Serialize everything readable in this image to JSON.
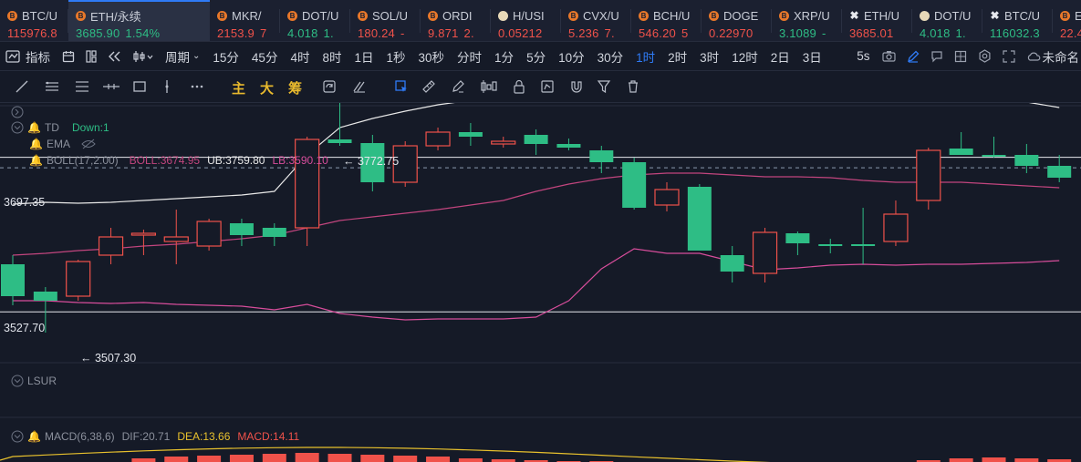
{
  "ticker": [
    {
      "symbol": "BTC/U",
      "price": "115976.8",
      "change": "",
      "dir": "dn",
      "icon": "coin-dot-icon"
    },
    {
      "symbol": "ETH/永续",
      "price": "3685.90",
      "change": "1.54%",
      "dir": "up",
      "icon": "coin-dot-icon",
      "active": true
    },
    {
      "symbol": "MKR/",
      "price": "2153.9",
      "change": "7",
      "dir": "dn",
      "icon": "coin-dot-icon"
    },
    {
      "symbol": "DOT/U",
      "price": "4.018",
      "change": "1.",
      "dir": "up",
      "icon": "coin-dot-icon"
    },
    {
      "symbol": "SOL/U",
      "price": "180.24",
      "change": "-",
      "dir": "dn",
      "icon": "coin-dot-icon"
    },
    {
      "symbol": "ORDI",
      "price": "9.871",
      "change": "2.",
      "dir": "dn",
      "icon": "coin-dot-icon"
    },
    {
      "symbol": "H/USI",
      "price": "0.05212",
      "change": "",
      "dir": "dn",
      "icon": "coin-light-icon"
    },
    {
      "symbol": "CVX/U",
      "price": "5.236",
      "change": "7.",
      "dir": "dn",
      "icon": "coin-dot-icon"
    },
    {
      "symbol": "BCH/U",
      "price": "546.20",
      "change": "5",
      "dir": "dn",
      "icon": "coin-dot-icon"
    },
    {
      "symbol": "DOGE",
      "price": "0.22970",
      "change": "",
      "dir": "dn",
      "icon": "coin-dot-icon"
    },
    {
      "symbol": "XRP/U",
      "price": "3.1089",
      "change": "-",
      "dir": "up",
      "icon": "coin-dot-icon"
    },
    {
      "symbol": "ETH/U",
      "price": "3685.01",
      "change": "",
      "dir": "dn",
      "icon": "exchange-x-icon"
    },
    {
      "symbol": "DOT/U",
      "price": "4.018",
      "change": "1.",
      "dir": "up",
      "icon": "coin-light-icon"
    },
    {
      "symbol": "BTC/U",
      "price": "116032.3",
      "change": "",
      "dir": "up",
      "icon": "exchange-x-icon"
    },
    {
      "symbol": "ETC/L",
      "price": "22.468",
      "change": "0",
      "dir": "dn",
      "icon": "coin-dot-icon"
    }
  ],
  "toolbar": {
    "indicators_label": "指标",
    "period_label": "周期",
    "periods": [
      "15分",
      "45分",
      "4时",
      "8时",
      "1日",
      "1秒",
      "30秒",
      "分时",
      "1分",
      "5分",
      "10分",
      "30分",
      "1时",
      "2时",
      "3时",
      "12时",
      "2日",
      "3日"
    ],
    "selected_period": "1时",
    "right_interval": "5s",
    "layout_name": "未命名"
  },
  "drawbar": {
    "main_label": "主",
    "big_label": "大",
    "chip_label": "筹"
  },
  "chart_data": [
    {
      "type": "candlestick",
      "title": "ETH/永续 1时",
      "ylim": [
        3490,
        3790
      ],
      "price_labels": {
        "upper": "3697.35",
        "lower": "3527.70"
      },
      "annotations": {
        "high": "3772.75",
        "low": "3507.30"
      },
      "x": [
        1,
        2,
        3,
        4,
        5,
        6,
        7,
        8,
        9,
        10,
        11,
        12,
        13,
        14,
        15,
        16,
        17,
        18,
        19,
        20,
        21,
        22,
        23,
        24,
        25,
        26,
        27,
        28,
        29,
        30,
        31,
        32,
        33
      ],
      "ohlc": [
        [
          3580,
          3590,
          3535,
          3545
        ],
        [
          3550,
          3555,
          3505,
          3540
        ],
        [
          3545,
          3585,
          3540,
          3583
        ],
        [
          3590,
          3620,
          3580,
          3610
        ],
        [
          3612,
          3618,
          3590,
          3614
        ],
        [
          3605,
          3640,
          3580,
          3610
        ],
        [
          3600,
          3630,
          3595,
          3627
        ],
        [
          3625,
          3630,
          3600,
          3612
        ],
        [
          3620,
          3625,
          3600,
          3610
        ],
        [
          3620,
          3720,
          3600,
          3717
        ],
        [
          3717,
          3773,
          3710,
          3713
        ],
        [
          3713,
          3722,
          3660,
          3670
        ],
        [
          3670,
          3715,
          3665,
          3710
        ],
        [
          3710,
          3730,
          3705,
          3725
        ],
        [
          3725,
          3735,
          3710,
          3720
        ],
        [
          3712,
          3720,
          3708,
          3715
        ],
        [
          3722,
          3728,
          3700,
          3712
        ],
        [
          3712,
          3718,
          3705,
          3708
        ],
        [
          3705,
          3710,
          3680,
          3692
        ],
        [
          3692,
          3697,
          3640,
          3642
        ],
        [
          3645,
          3670,
          3638,
          3662
        ],
        [
          3665,
          3668,
          3595,
          3595
        ],
        [
          3590,
          3600,
          3560,
          3572
        ],
        [
          3570,
          3620,
          3560,
          3615
        ],
        [
          3614,
          3616,
          3590,
          3603
        ],
        [
          3602,
          3608,
          3592,
          3600
        ],
        [
          3602,
          3642,
          3580,
          3600
        ],
        [
          3605,
          3650,
          3600,
          3635
        ],
        [
          3650,
          3708,
          3640,
          3705
        ],
        [
          3707,
          3725,
          3700,
          3700
        ],
        [
          3700,
          3720,
          3697,
          3698
        ],
        [
          3700,
          3712,
          3680,
          3688
        ],
        [
          3688,
          3700,
          3670,
          3675
        ]
      ],
      "indicators": {
        "td": {
          "label": "TD",
          "value_label": "Down:1"
        },
        "ema": {
          "label": "EMA"
        },
        "boll": {
          "label": "BOLL(17,2.00)",
          "boll_label": "BOLL:3674.95",
          "ub_label": "UB:3759.80",
          "lb_label": "LB:3590.10",
          "ub": [
            3646,
            3648,
            3647,
            3648,
            3650,
            3652,
            3654,
            3656,
            3660,
            3700,
            3730,
            3740,
            3748,
            3755,
            3760,
            3768,
            3775,
            3778,
            3778,
            3775,
            3770,
            3768,
            3765,
            3762,
            3760,
            3760,
            3760,
            3760,
            3758,
            3762,
            3762,
            3758,
            3752
          ],
          "mid": [
            3590,
            3592,
            3595,
            3597,
            3600,
            3602,
            3605,
            3608,
            3612,
            3620,
            3628,
            3632,
            3636,
            3640,
            3645,
            3650,
            3660,
            3668,
            3674,
            3678,
            3680,
            3680,
            3678,
            3676,
            3676,
            3675,
            3672,
            3670,
            3670,
            3670,
            3668,
            3666,
            3664
          ],
          "lb": [
            3540,
            3540,
            3538,
            3537,
            3538,
            3536,
            3535,
            3534,
            3530,
            3536,
            3526,
            3522,
            3519,
            3520,
            3520,
            3520,
            3522,
            3540,
            3575,
            3597,
            3592,
            3592,
            3583,
            3574,
            3576,
            3579,
            3580,
            3579,
            3580,
            3580,
            3581,
            3582,
            3584
          ]
        },
        "lsur": {
          "label": "LSUR"
        },
        "macd": {
          "label": "MACD(6,38,6)",
          "dif_label": "DIF:20.71",
          "dea_label": "DEA:13.66",
          "macd_label": "MACD:14.11"
        }
      }
    }
  ],
  "colors": {
    "up": "#2ebd85",
    "down": "#f0524a",
    "accent": "#2f7bf6",
    "bg": "#151a27"
  }
}
